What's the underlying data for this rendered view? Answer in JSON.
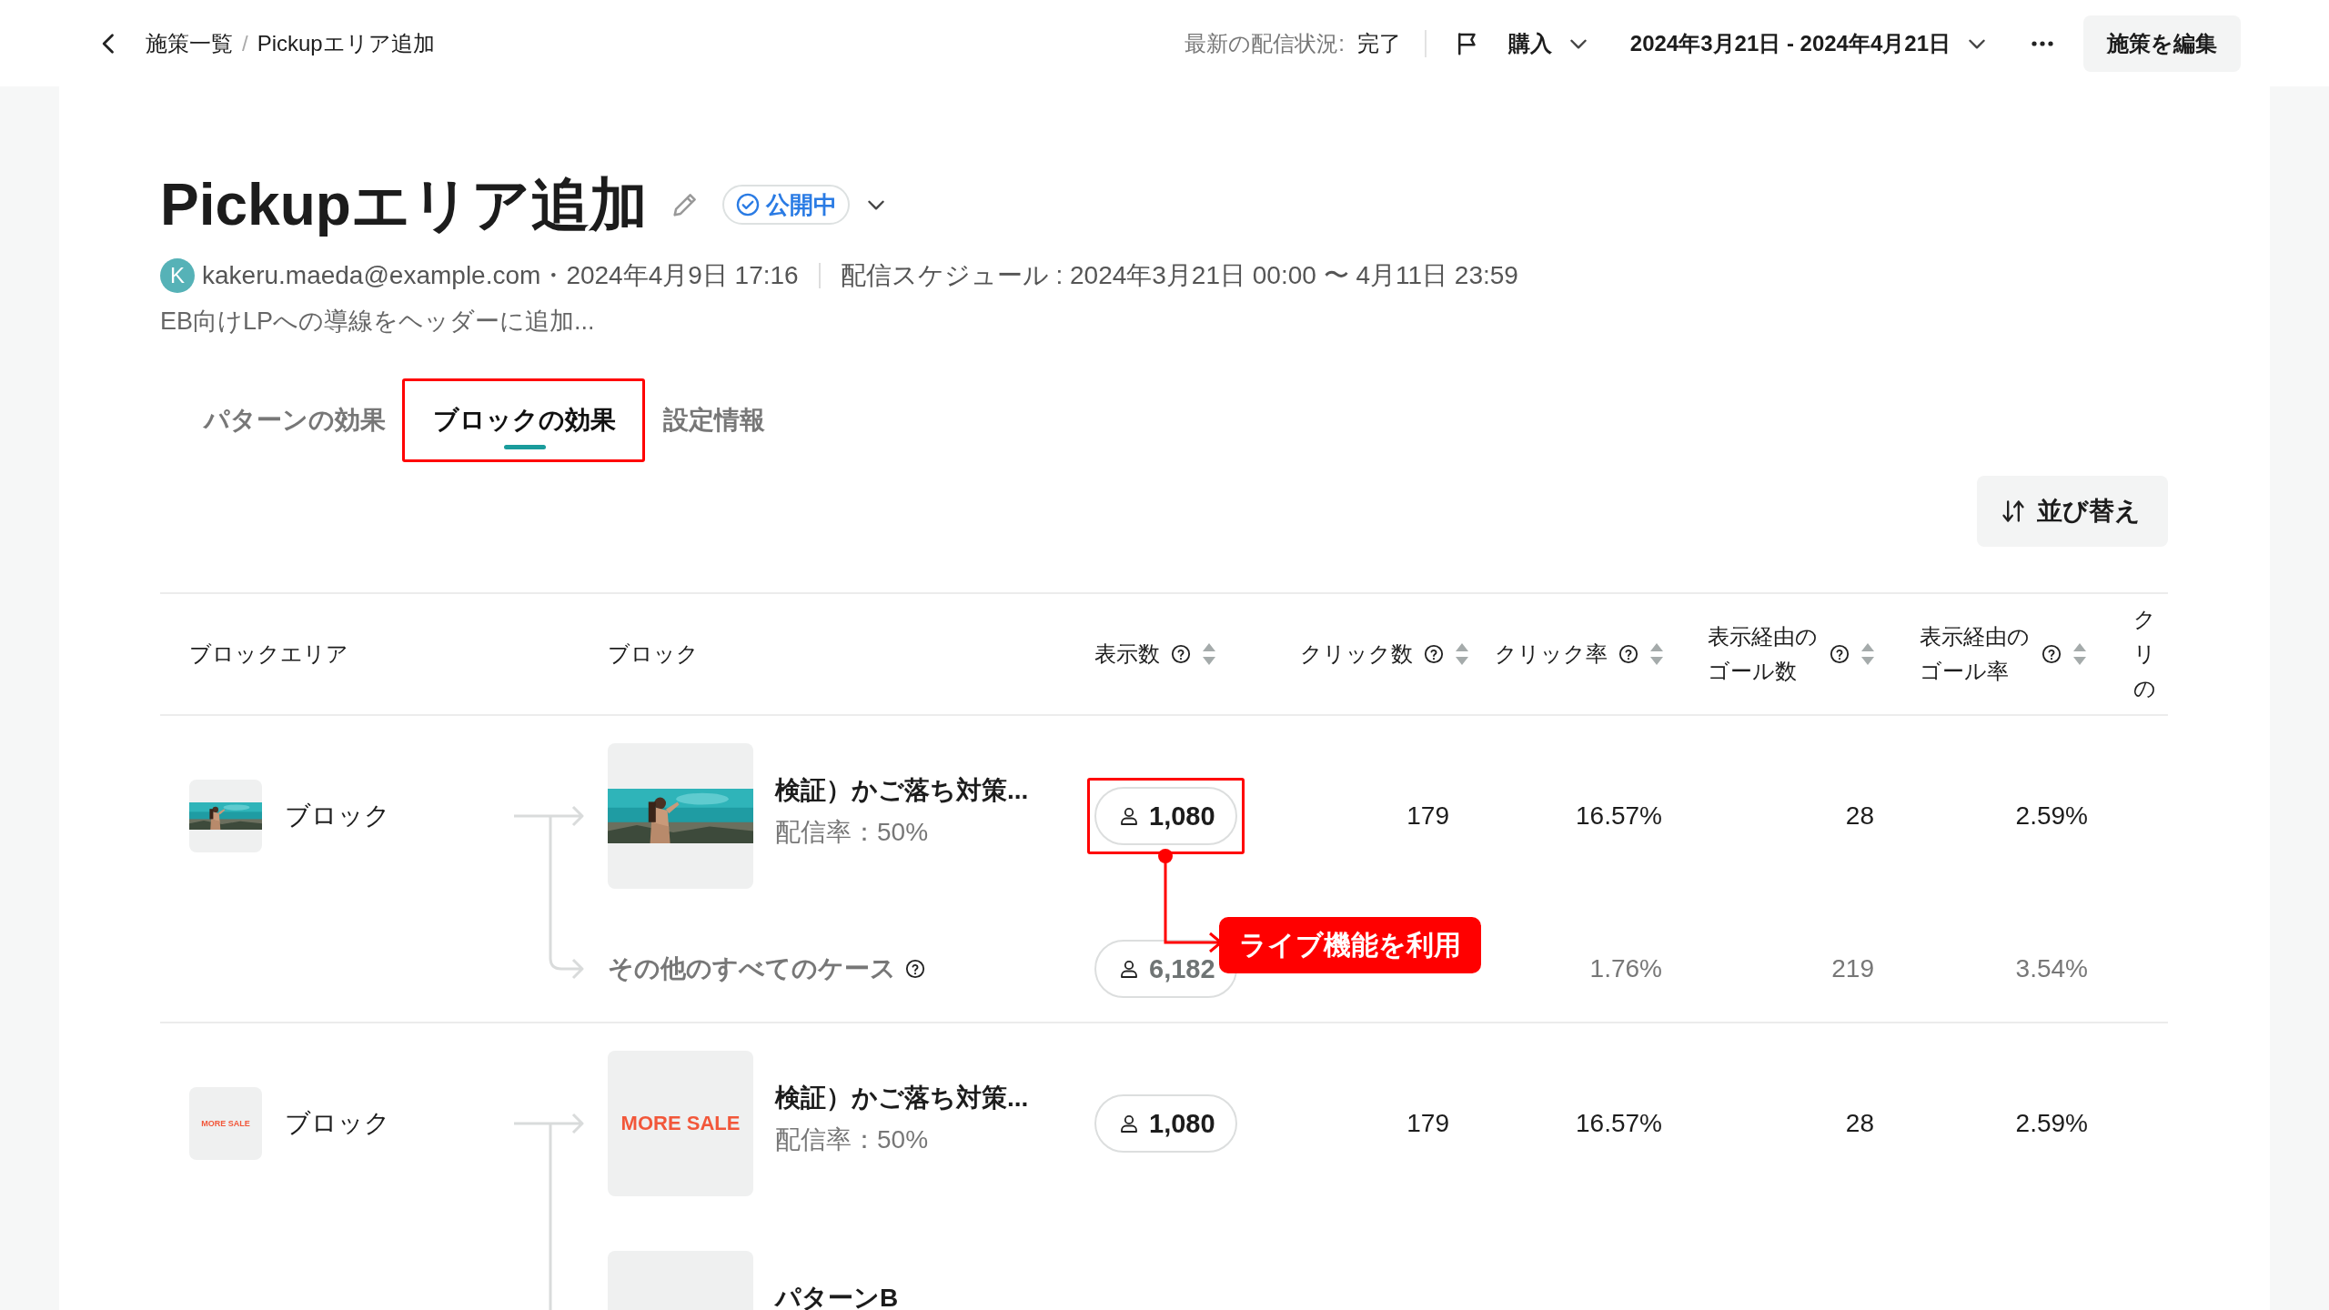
{
  "topbar": {
    "breadcrumb": [
      {
        "label": "施策一覧"
      },
      {
        "label": "Pickupエリア追加"
      }
    ],
    "separator": "/",
    "status_label": "最新の配信状況:",
    "status_value": "完了",
    "goal": "購入",
    "date_range": "2024年3月21日 - 2024年4月21日",
    "edit_button": "施策を編集"
  },
  "header": {
    "title": "Pickupエリア追加",
    "status": "公開中",
    "avatar": "K",
    "author": "kakeru.maeda@example.com",
    "updated": "・2024年4月9日 17:16",
    "schedule": "配信スケジュール : 2024年3月21日 00:00 〜 4月11日 23:59",
    "description": "EB向けLPへの導線をヘッダーに追加..."
  },
  "tabs": [
    {
      "label": "パターンの効果",
      "selected": false,
      "highlighted": false
    },
    {
      "label": "ブロックの効果",
      "selected": true,
      "highlighted": true
    },
    {
      "label": "設定情報",
      "selected": false,
      "highlighted": false
    }
  ],
  "sort_button": "並び替え",
  "table": {
    "columns": [
      {
        "label": "ブロックエリア",
        "help": false,
        "sortable": false
      },
      {
        "label": "ブロック",
        "help": false,
        "sortable": false
      },
      {
        "label": "表示数",
        "help": true,
        "sortable": true
      },
      {
        "label": "クリック数",
        "help": true,
        "sortable": true
      },
      {
        "label": "クリック率",
        "help": true,
        "sortable": true
      },
      {
        "label": "表示経由のゴール数",
        "help": true,
        "sortable": true
      },
      {
        "label": "表示経由のゴール率",
        "help": true,
        "sortable": true
      },
      {
        "label": "クリの",
        "help": false,
        "sortable": false
      }
    ],
    "rows": [
      {
        "area": {
          "label": "ブロック"
        },
        "patterns": [
          {
            "kind": "variant",
            "title": "検証）かご落ち対策...",
            "rate": "配信率：50%",
            "impressions": "1,080",
            "clicks": "179",
            "click_rate": "16.57%",
            "goals": "28",
            "goal_rate": "2.59%",
            "callout": "ライブ機能を利用"
          },
          {
            "kind": "others",
            "label": "その他のすべてのケース",
            "help": true,
            "impressions": "6,182",
            "click_rate": "1.76%",
            "goals": "219",
            "goal_rate": "3.54%"
          }
        ]
      },
      {
        "area": {
          "thumb": {
            "kind": "banner",
            "text": "MORE SALE"
          },
          "label": "ブロック"
        },
        "patterns": [
          {
            "kind": "variant",
            "thumb": {
              "kind": "banner",
              "text": "MORE SALE"
            },
            "title": "検証）かご落ち対策...",
            "rate": "配信率：50%",
            "impressions": "1,080",
            "clicks": "179",
            "click_rate": "16.57%",
            "goals": "28",
            "goal_rate": "2.59%"
          },
          {
            "kind": "variant",
            "thumb": {
              "kind": "blank"
            },
            "title": "パターンB"
          }
        ]
      }
    ]
  }
}
